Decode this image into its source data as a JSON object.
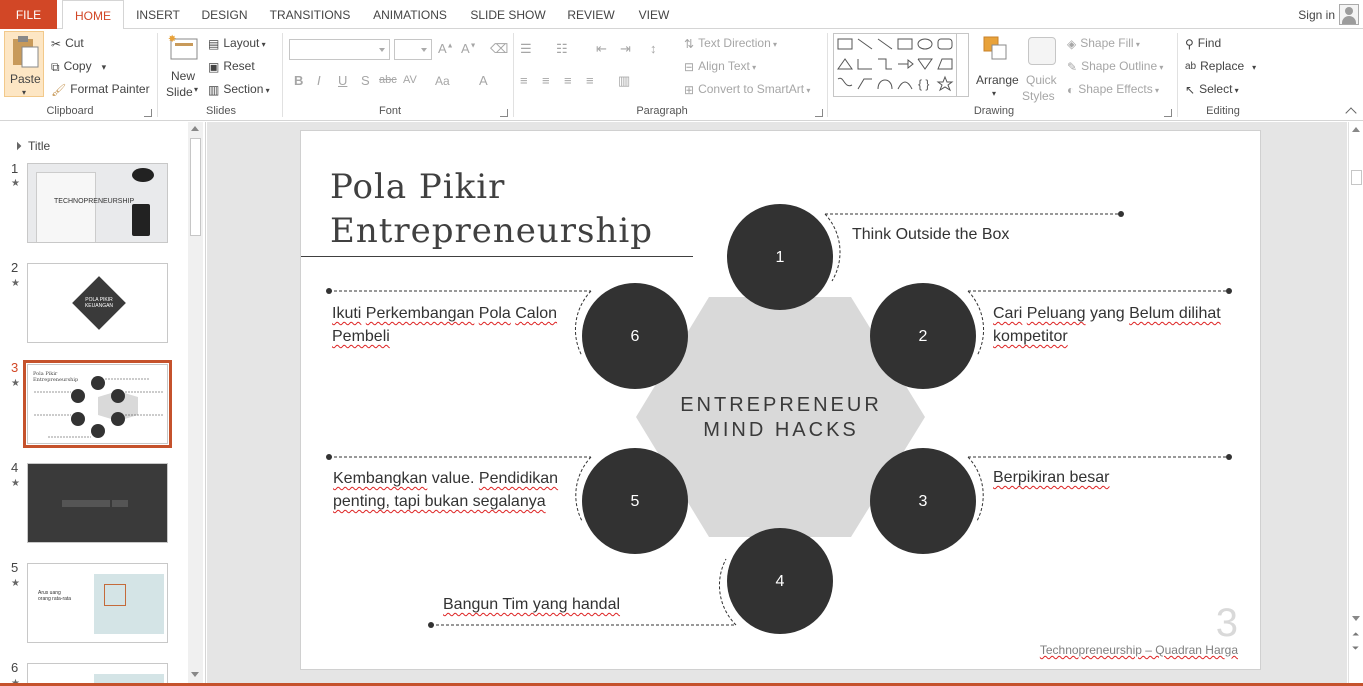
{
  "tabs": {
    "file": "FILE",
    "items": [
      "HOME",
      "INSERT",
      "DESIGN",
      "TRANSITIONS",
      "ANIMATIONS",
      "SLIDE SHOW",
      "REVIEW",
      "VIEW"
    ],
    "active": "HOME",
    "signin": "Sign in"
  },
  "ribbon": {
    "clipboard": {
      "label": "Clipboard",
      "paste": "Paste",
      "cut": "Cut",
      "copy": "Copy",
      "format_painter": "Format Painter"
    },
    "slides": {
      "label": "Slides",
      "new_slide_1": "New",
      "new_slide_2": "Slide",
      "layout": "Layout",
      "reset": "Reset",
      "section": "Section"
    },
    "font": {
      "label": "Font",
      "bold": "B",
      "italic": "I",
      "underline": "U",
      "shadow": "S",
      "strike": "abc",
      "spacing": "AV",
      "case": "Aa",
      "color": "A"
    },
    "paragraph": {
      "label": "Paragraph",
      "text_direction": "Text Direction",
      "align_text": "Align Text",
      "smartart": "Convert to SmartArt"
    },
    "drawing": {
      "label": "Drawing",
      "arrange": "Arrange",
      "quick_styles_1": "Quick",
      "quick_styles_2": "Styles",
      "shape_fill": "Shape Fill",
      "shape_outline": "Shape Outline",
      "shape_effects": "Shape Effects"
    },
    "editing": {
      "label": "Editing",
      "find": "Find",
      "replace": "Replace",
      "select": "Select"
    }
  },
  "thumbnails": {
    "section": "Title",
    "slides": [
      {
        "num": "1",
        "text": "TECHNOPRENEURSHIP"
      },
      {
        "num": "2",
        "text1": "POLA PIKIR",
        "text2": "KEUANGAN"
      },
      {
        "num": "3",
        "text": "Pola Pikir Entrepreneurship"
      },
      {
        "num": "4"
      },
      {
        "num": "5",
        "text1": "Arus uang",
        "text2": "orang rata-rata"
      },
      {
        "num": "6"
      }
    ],
    "selected": "3"
  },
  "slide": {
    "title": "Pola Pikir\nEntrepreneurship",
    "center_line1": "ENTREPRENEUR",
    "center_line2": "MIND HACKS",
    "nodes": [
      "1",
      "2",
      "3",
      "4",
      "5",
      "6"
    ],
    "items": {
      "one": "Think Outside the Box",
      "two_a": "Cari",
      "two_b": "Peluang",
      "two_c": "yang",
      "two_d": "Belum dilihat",
      "two_e": "kompetitor",
      "three_a": "Berpikiran besar",
      "four": "Bangun Tim yang handal",
      "five_a": "Kembangkan",
      "five_b": "value.",
      "five_c": "Pendidikan",
      "five_d": "penting, tapi bukan segalanya",
      "six_a": "Ikuti",
      "six_b": "Perkembangan",
      "six_c": "Pola",
      "six_d": "Calon",
      "six_e": "Pembeli"
    },
    "slide_number": "3",
    "footer": "Technopreneurship – Quadran Harga"
  },
  "colors": {
    "accent": "#d24726",
    "circle": "#323232",
    "hexagon": "#d9d9d9"
  }
}
